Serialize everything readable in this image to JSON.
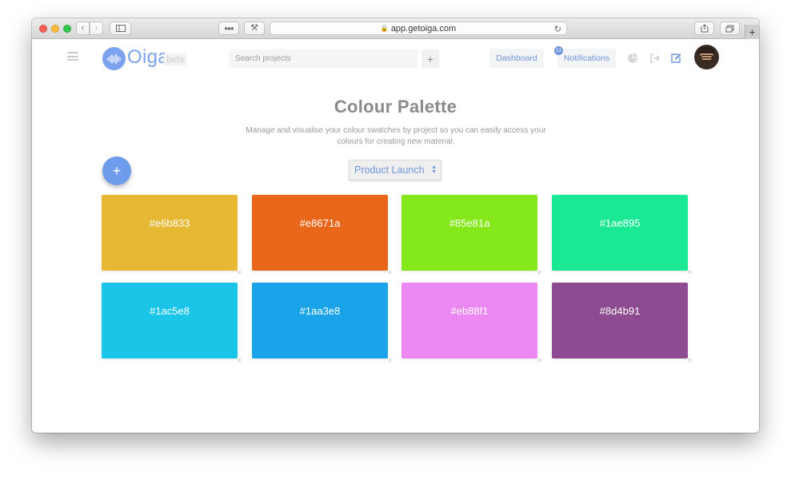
{
  "browser": {
    "url": "app.getoiga.com"
  },
  "header": {
    "logo_text": "Oiga",
    "beta_label": "beta",
    "search_placeholder": "Search projects",
    "add_label": "+",
    "dashboard_label": "Dashboard",
    "notifications_label": "Notifications",
    "notifications_count": "13"
  },
  "page": {
    "title": "Colour Palette",
    "subtitle": "Manage and visualise your colour swatches by project so you can easily access your colours for creating new material.",
    "add_button": "+",
    "selected_project": "Product Launch"
  },
  "swatches": [
    {
      "label": "#e6b833",
      "color": "#e6b833"
    },
    {
      "label": "#e8671a",
      "color": "#e8671a"
    },
    {
      "label": "#85e81a",
      "color": "#85e81a"
    },
    {
      "label": "#1ae895",
      "color": "#1ae895"
    },
    {
      "label": "#1ac5e8",
      "color": "#1ac5e8"
    },
    {
      "label": "#1aa3e8",
      "color": "#1aa3e8"
    },
    {
      "label": "#eb88f1",
      "color": "#eb88f1"
    },
    {
      "label": "#8d4b91",
      "color": "#8d4b91"
    }
  ],
  "colors": {
    "accent": "#6f95dd",
    "brand": "#7aa2ee"
  },
  "icons": {
    "menu": "hamburger-icon",
    "stats": "pie-chart-icon",
    "logout": "sign-out-icon",
    "edit": "edit-icon",
    "delete": "close-icon"
  }
}
